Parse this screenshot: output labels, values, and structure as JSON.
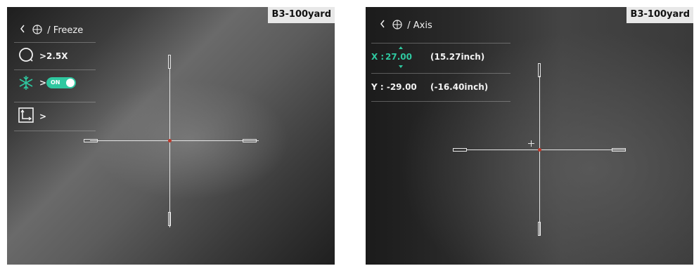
{
  "left_screen": {
    "preset": "B3-100yard",
    "back_icon": "chevron-left-icon",
    "reticle_icon": "crosshair-circle-icon",
    "title": "/ Freeze",
    "menu": [
      {
        "icon": "zoom-icon",
        "arrow": ">",
        "value": "2.5X"
      },
      {
        "icon": "snowflake-icon",
        "arrow": ">",
        "toggle_label": "ON",
        "toggle_state": true
      },
      {
        "icon": "axis-icon",
        "arrow": ">"
      }
    ]
  },
  "right_screen": {
    "preset": "B3-100yard",
    "back_icon": "chevron-left-icon",
    "reticle_icon": "crosshair-circle-icon",
    "title": "/ Axis",
    "x_label": "X :",
    "x_value": "27.00",
    "x_inch": "(15.27inch)",
    "y_label": "Y : -29.00",
    "y_inch": "(-16.40inch)",
    "colors": {
      "accent": "#2fc8a0",
      "reticle_center": "#c0392b"
    }
  }
}
